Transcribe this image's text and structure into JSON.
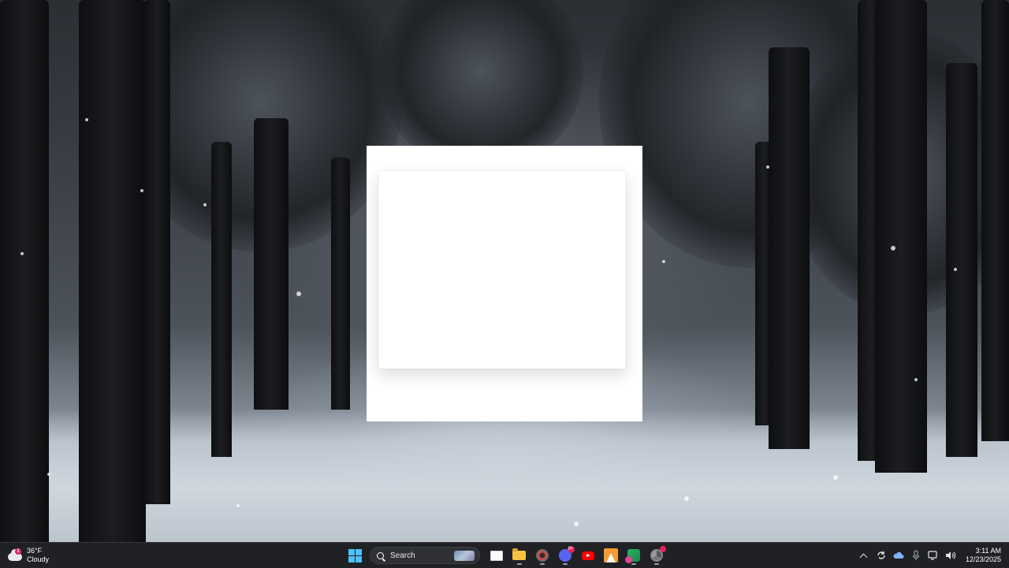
{
  "taskbar": {
    "weather": {
      "temperature": "36°F",
      "condition": "Cloudy",
      "alert_badge": "1",
      "icon": "cloud-icon"
    },
    "search": {
      "label": "Search"
    },
    "apps": [
      {
        "name": "start",
        "icon": "windows-logo-icon"
      },
      {
        "name": "task-view",
        "icon": "task-view-icon"
      },
      {
        "name": "file-explorer",
        "icon": "folder-icon"
      },
      {
        "name": "settings-app",
        "icon": "gear-icon"
      },
      {
        "name": "discord",
        "icon": "discord-icon",
        "badge": "9+"
      },
      {
        "name": "youtube",
        "icon": "youtube-icon"
      },
      {
        "name": "vlc-like-app",
        "icon": "triangle-app-icon"
      },
      {
        "name": "green-app",
        "icon": "green-app-icon"
      },
      {
        "name": "chrome",
        "icon": "chrome-icon"
      }
    ],
    "clock": {
      "time": "3:11 AM",
      "date": "12/23/2025"
    }
  },
  "colors": {
    "taskbar_bg": "#202124",
    "start_blue": "#4cc2ff",
    "window_bg": "#ffffff"
  }
}
